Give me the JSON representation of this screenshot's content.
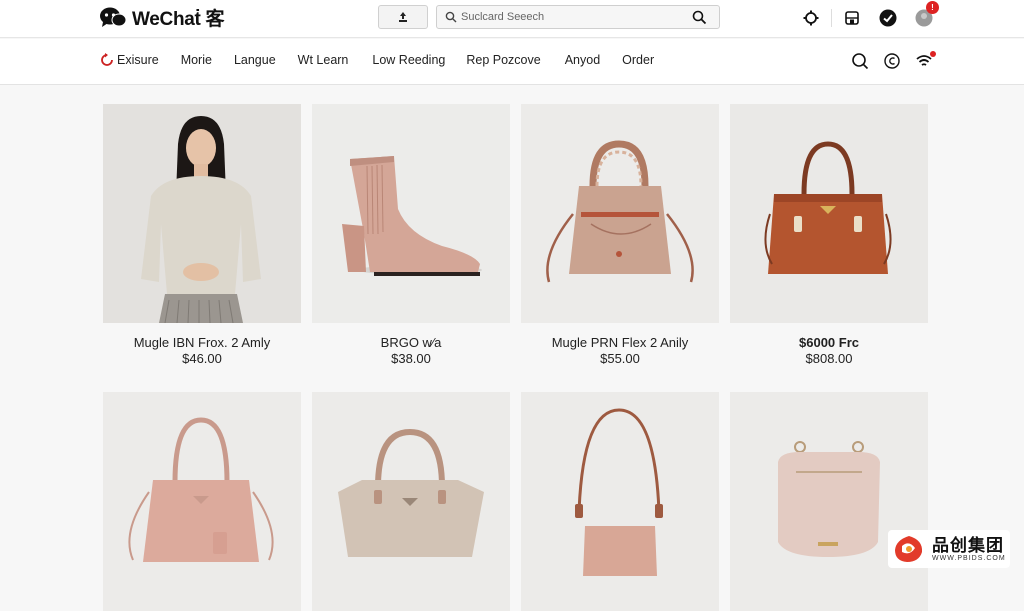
{
  "header": {
    "logo_text": "WeChaṫ 客",
    "search": {
      "placeholder": "Suclcard Seeech"
    },
    "notification_badge": "!"
  },
  "nav": {
    "items": [
      {
        "label": "Exisure",
        "width": 0
      },
      {
        "label": "Morie"
      },
      {
        "label": "Langue"
      },
      {
        "label": "Wt Learn"
      },
      {
        "label": "Low Reeding"
      },
      {
        "label": "Rep Pozcove"
      },
      {
        "label": "Anyod"
      },
      {
        "label": "Order"
      }
    ]
  },
  "products": [
    {
      "name": "Mugle IBN Frox. 2 Amly",
      "price": "$46.00",
      "image": "woman-sweater"
    },
    {
      "name": "BRGO w∕a",
      "price": "$38.00",
      "image": "pink-ankle-boot"
    },
    {
      "name": "Mugle PRN Flex 2 Anily",
      "price": "$55.00",
      "image": "woven-handle-bag"
    },
    {
      "name": "$6000 Frc",
      "price": "$808.00",
      "image": "brown-handbag"
    },
    {
      "name": "",
      "price": "",
      "image": "pink-tote"
    },
    {
      "name": "",
      "price": "",
      "image": "beige-tote"
    },
    {
      "name": "",
      "price": "",
      "image": "shoulder-bag"
    },
    {
      "name": "",
      "price": "",
      "image": "pouch-bag"
    }
  ],
  "watermark": {
    "title": "品创集团",
    "sub": "WWW.PBIDS.COM"
  },
  "colors": {
    "accent": "#d22222",
    "blush": "#d9a89a",
    "cognac": "#b5552f"
  }
}
